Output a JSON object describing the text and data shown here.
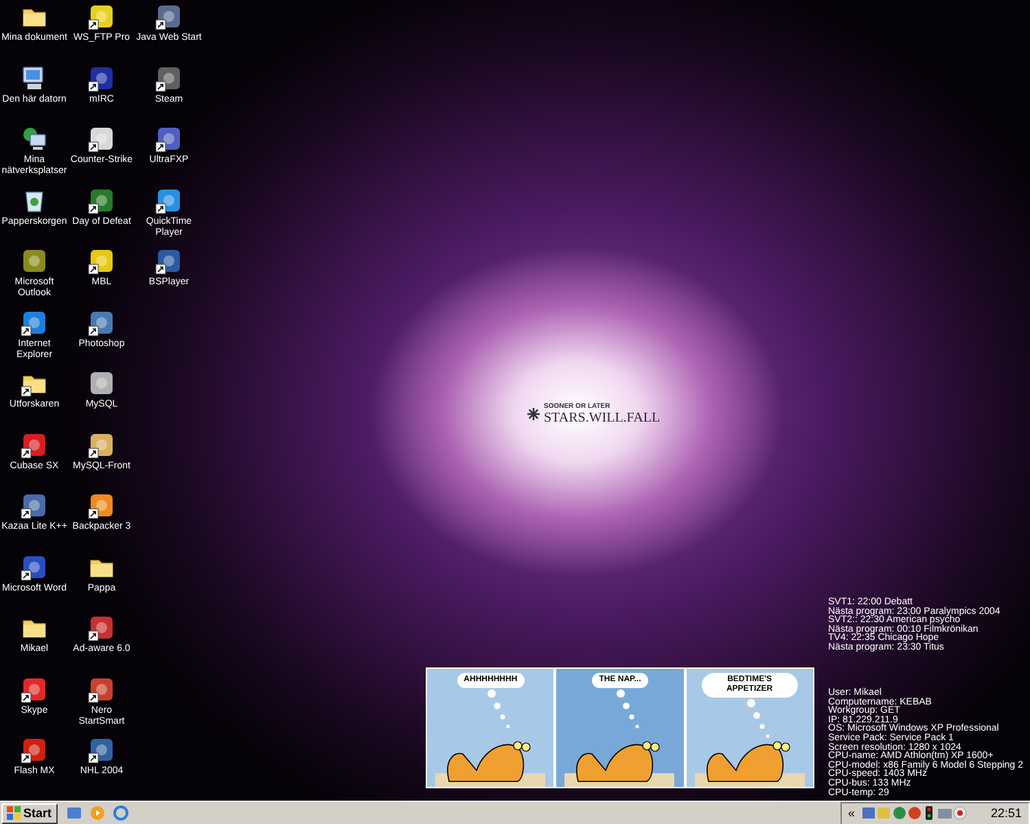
{
  "desktop_icons": [
    {
      "label": "Mina dokument",
      "kind": "folder",
      "shortcut": false
    },
    {
      "label": "Den här datorn",
      "kind": "computer",
      "shortcut": false
    },
    {
      "label": "Mina nätverksplatser",
      "kind": "network",
      "shortcut": false
    },
    {
      "label": "Papperskorgen",
      "kind": "recycle",
      "shortcut": false
    },
    {
      "label": "Microsoft Outlook",
      "kind": "app",
      "color": "#8a8a1e",
      "shortcut": false
    },
    {
      "label": "Internet Explorer",
      "kind": "app",
      "color": "#1e7fd8",
      "shortcut": true
    },
    {
      "label": "Utforskaren",
      "kind": "folder",
      "shortcut": true
    },
    {
      "label": "Cubase SX",
      "kind": "app",
      "color": "#d81e1e",
      "shortcut": true
    },
    {
      "label": "Kazaa Lite K++",
      "kind": "app",
      "color": "#4a6aa8",
      "shortcut": true
    },
    {
      "label": "Microsoft Word",
      "kind": "app",
      "color": "#2a4ec0",
      "shortcut": true
    },
    {
      "label": "Mikael",
      "kind": "folder",
      "shortcut": false
    },
    {
      "label": "Skype",
      "kind": "app",
      "color": "#e02a2a",
      "shortcut": true
    },
    {
      "label": "Flash MX",
      "kind": "app",
      "color": "#d02010",
      "shortcut": true
    },
    {
      "label": "WS_FTP Pro",
      "kind": "app",
      "color": "#e8d020",
      "shortcut": true
    },
    {
      "label": "mIRC",
      "kind": "app",
      "color": "#2030a0",
      "shortcut": true
    },
    {
      "label": "Counter-Strike",
      "kind": "app",
      "color": "#d8d8d8",
      "shortcut": true
    },
    {
      "label": "Day of Defeat",
      "kind": "app",
      "color": "#2a7a2a",
      "shortcut": true
    },
    {
      "label": "MBL",
      "kind": "app",
      "color": "#e8c810",
      "shortcut": true
    },
    {
      "label": "Photoshop",
      "kind": "app",
      "color": "#4a78b0",
      "shortcut": true
    },
    {
      "label": "MySQL",
      "kind": "app",
      "color": "#b0b0b0",
      "shortcut": false
    },
    {
      "label": "MySQL-Front",
      "kind": "app",
      "color": "#d8b060",
      "shortcut": true
    },
    {
      "label": "Backpacker 3",
      "kind": "app",
      "color": "#f08a20",
      "shortcut": true
    },
    {
      "label": "Pappa",
      "kind": "folder",
      "shortcut": false
    },
    {
      "label": "Ad-aware 6.0",
      "kind": "app",
      "color": "#c83030",
      "shortcut": true
    },
    {
      "label": "Nero StartSmart",
      "kind": "app",
      "color": "#c84030",
      "shortcut": true
    },
    {
      "label": "NHL 2004",
      "kind": "app",
      "color": "#3060a0",
      "shortcut": true
    },
    {
      "label": "Java Web Start",
      "kind": "app",
      "color": "#5a6a90",
      "shortcut": true
    },
    {
      "label": "Steam",
      "kind": "app",
      "color": "#606060",
      "shortcut": true
    },
    {
      "label": "UltraFXP",
      "kind": "app",
      "color": "#5060c0",
      "shortcut": true
    },
    {
      "label": "QuickTime Player",
      "kind": "app",
      "color": "#2a90e0",
      "shortcut": true
    },
    {
      "label": "BSPlayer",
      "kind": "app",
      "color": "#2a5aa0",
      "shortcut": true
    }
  ],
  "wallpaper": {
    "tagline": "SOONER OR LATER",
    "title": "STARS.WILL.FALL"
  },
  "tv_guide": [
    "SVT1: 22:00 Debatt",
    "Nästa program: 23:00 Paralympics 2004",
    "SVT2:: 22:30 American psycho",
    "Nästa program: 00:10 Filmkrönikan",
    "TV4: 22:35 Chicago Hope",
    "Nästa program: 23:30 Titus"
  ],
  "system_info": [
    "User: Mikael",
    "Computername: KEBAB",
    "Workgroup: GET",
    "IP: 81.229.211.9",
    "OS: Microsoft Windows XP Professional",
    "Service Pack: Service Pack 1",
    "Screen resolution: 1280 x 1024",
    "CPU-name: AMD Athlon(tm) XP 1600+",
    "CPU-model: x86 Family 6 Model 6 Stepping 2",
    "CPU-speed: 1403 MHz",
    "CPU-bus: 133 MHz",
    "CPU-temp: 29"
  ],
  "comic": {
    "panels": [
      {
        "caption": "AHHHHHHHH",
        "color": "#a8c8e8"
      },
      {
        "caption": "THE NAP...",
        "color": "#78a8d8"
      },
      {
        "caption": "BEDTIME'S APPETIZER",
        "color": "#a8c8e8"
      }
    ]
  },
  "taskbar": {
    "start": "Start",
    "tray_expand": "«",
    "clock": "22:51"
  }
}
